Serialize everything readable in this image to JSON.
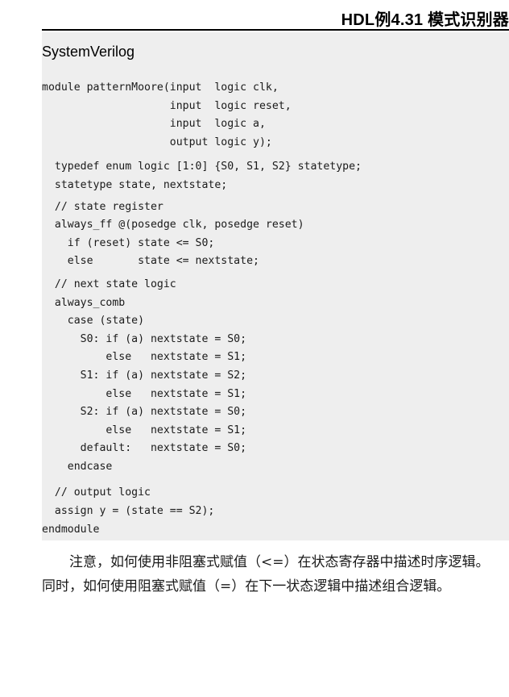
{
  "header": {
    "title": "HDL例4.31  模式识别器"
  },
  "code_block": {
    "language": "SystemVerilog",
    "lines": [
      "module patternMoore(input  logic clk,",
      "                    input  logic reset,",
      "                    input  logic a,",
      "                    output logic y);",
      "  typedef enum logic [1:0] {S0, S1, S2} statetype;",
      "  statetype state, nextstate;",
      "  // state register",
      "  always_ff @(posedge clk, posedge reset)",
      "    if (reset) state <= S0;",
      "    else       state <= nextstate;",
      "  // next state logic",
      "  always_comb",
      "    case (state)",
      "      S0: if (a) nextstate = S0;",
      "          else   nextstate = S1;",
      "      S1: if (a) nextstate = S2;",
      "          else   nextstate = S1;",
      "      S2: if (a) nextstate = S0;",
      "          else   nextstate = S1;",
      "      default:   nextstate = S0;",
      "    endcase",
      "  // output logic",
      "  assign y = (state == S2);",
      "endmodule"
    ]
  },
  "note": {
    "text": "注意，如何使用非阻塞式赋值（<=）在状态寄存器中描述时序逻辑。同时，如何使用阻塞式赋值（=）在下一状态逻辑中描述组合逻辑。"
  }
}
